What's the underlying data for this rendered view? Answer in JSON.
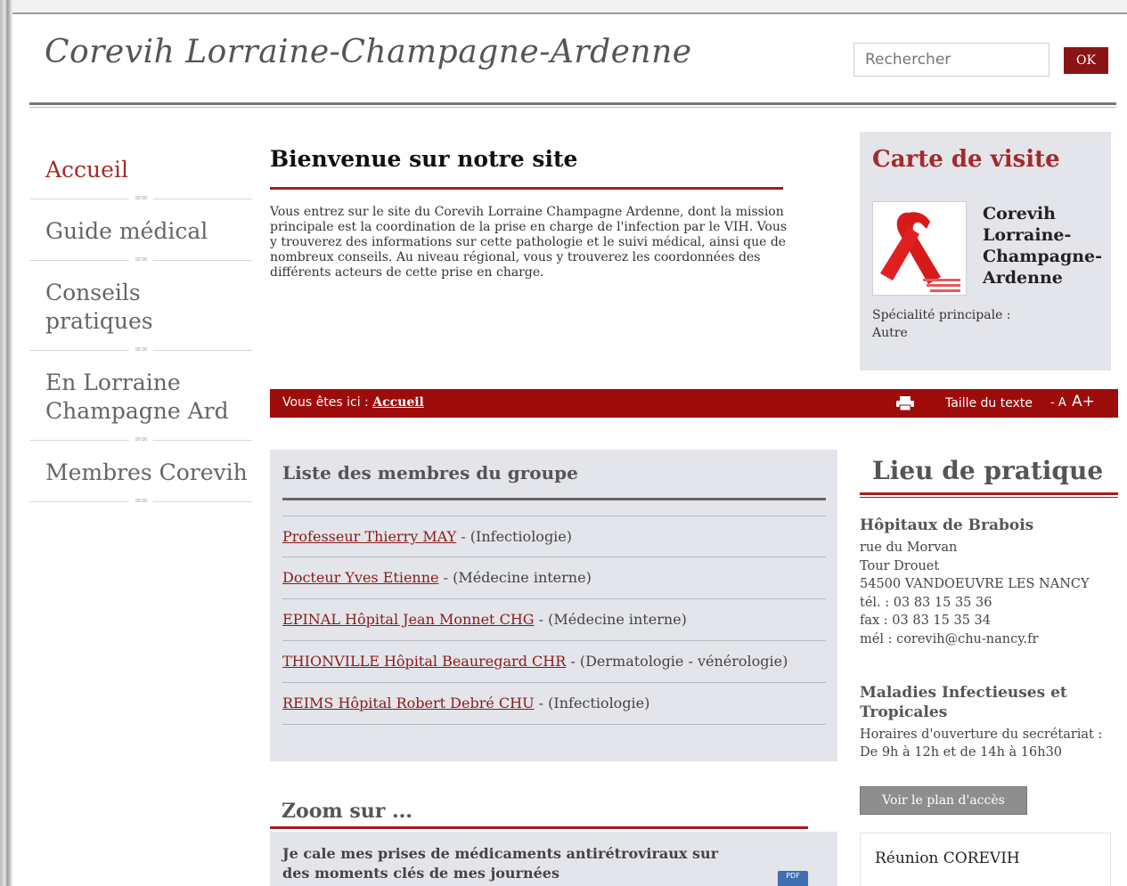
{
  "header": {
    "logo_text": "Corevih Lorraine-Champagne-Ardenne",
    "search_placeholder": "Rechercher",
    "ok_label": "OK"
  },
  "sidebar": {
    "items": [
      {
        "label": "Accueil",
        "active": true
      },
      {
        "label": "Guide médical"
      },
      {
        "label": "Conseils pratiques"
      },
      {
        "label": "En Lorraine Champagne Ard"
      },
      {
        "label": "Membres Corevih"
      }
    ]
  },
  "welcome": {
    "title": "Bienvenue sur notre site",
    "text": "Vous entrez sur le site du Corevih Lorraine Champagne Ardenne, dont la mission principale est la coordination de la prise en charge de l'infection par le VIH. Vous y trouverez des informations sur cette pathologie et le suivi médical, ainsi que de nombreux conseils. Au niveau régional, vous y trouverez les coordonnées des différents acteurs de cette prise en charge."
  },
  "card": {
    "title": "Carte de visite",
    "name": "Corevih Lorraine-Champagne-Ardenne",
    "spec_label": "Spécialité principale :",
    "spec_value": "Autre",
    "logo_icon": "red-ribbon-icon"
  },
  "breadcrumb": {
    "prefix": "Vous êtes ici :",
    "current": "Accueil",
    "text_size_label": "Taille du texte",
    "minus": "- A",
    "plus": "A+",
    "print_icon": "printer-icon"
  },
  "members": {
    "title": "Liste des membres du groupe",
    "items": [
      {
        "name": "Professeur Thierry MAY",
        "spec": "- (Infectiologie)"
      },
      {
        "name": "Docteur Yves Etienne",
        "spec": "- (Médecine interne)"
      },
      {
        "name": "EPINAL Hôpital Jean Monnet CHG",
        "spec": "- (Médecine interne)"
      },
      {
        "name": "THIONVILLE Hôpital Beauregard CHR",
        "spec": "- (Dermatologie - vénérologie)"
      },
      {
        "name": "REIMS Hôpital Robert Debré CHU",
        "spec": "- (Infectiologie)"
      }
    ]
  },
  "zoom": {
    "title": "Zoom sur ...",
    "text": "Je cale mes prises de médicaments antirétroviraux sur des moments clés de mes journées",
    "pdf_label": "PDF"
  },
  "lieu": {
    "title": "Lieu de pratique",
    "hospital": "Hôpitaux de Brabois",
    "address": [
      "rue du Morvan",
      "Tour Drouet",
      "54500 VANDOEUVRE LES NANCY",
      "tél. : 03 83 15 35 36",
      "fax : 03 83 15 35 34",
      "mél : corevih@chu-nancy.fr"
    ],
    "service": "Maladies Infectieuses et Tropicales",
    "hours_label": "Horaires d'ouverture du secrétariat :",
    "hours": "De 9h à 12h et de 14h à 16h30",
    "plan_button": "Voir le plan d'accès",
    "reunion_title": "Réunion COREVIH"
  },
  "colors": {
    "accent": "#9e0b0b",
    "panel": "#e3e5ea"
  }
}
